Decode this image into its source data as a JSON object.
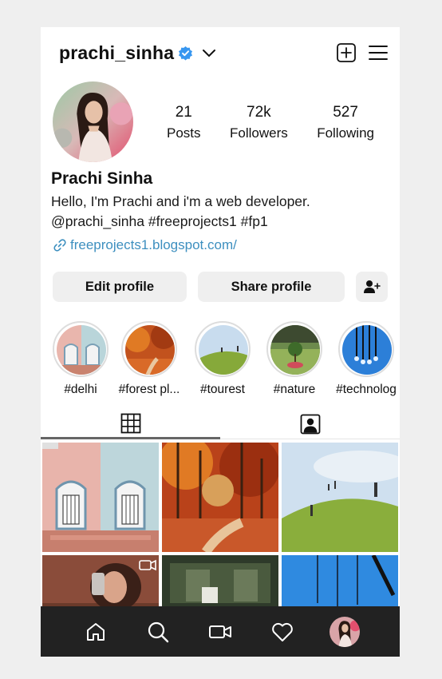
{
  "header": {
    "username": "prachi_sinha"
  },
  "stats": [
    {
      "num": "21",
      "label": "Posts"
    },
    {
      "num": "72k",
      "label": "Followers"
    },
    {
      "num": "527",
      "label": "Following"
    }
  ],
  "profile": {
    "name": "Prachi Sinha",
    "bio_line1": "Hello, I'm Prachi and i'm a web developer.",
    "bio_line2": "@prachi_sinha #freeprojects1 #fp1",
    "link": "freeprojects1.blogspot.com/"
  },
  "actions": {
    "edit": "Edit profile",
    "share": "Share profile"
  },
  "highlights": [
    {
      "label": "#delhi"
    },
    {
      "label": "#forest pl..."
    },
    {
      "label": "#tourest"
    },
    {
      "label": "#nature"
    },
    {
      "label": "#technolog"
    }
  ],
  "colors": {
    "verified": "#3897f0",
    "link": "#3d8fbf",
    "nav_bg": "#222222"
  },
  "icons": [
    "new-post-icon",
    "menu-icon",
    "grid-icon",
    "tagged-icon",
    "home-icon",
    "search-icon",
    "reels-icon",
    "heart-icon"
  ]
}
